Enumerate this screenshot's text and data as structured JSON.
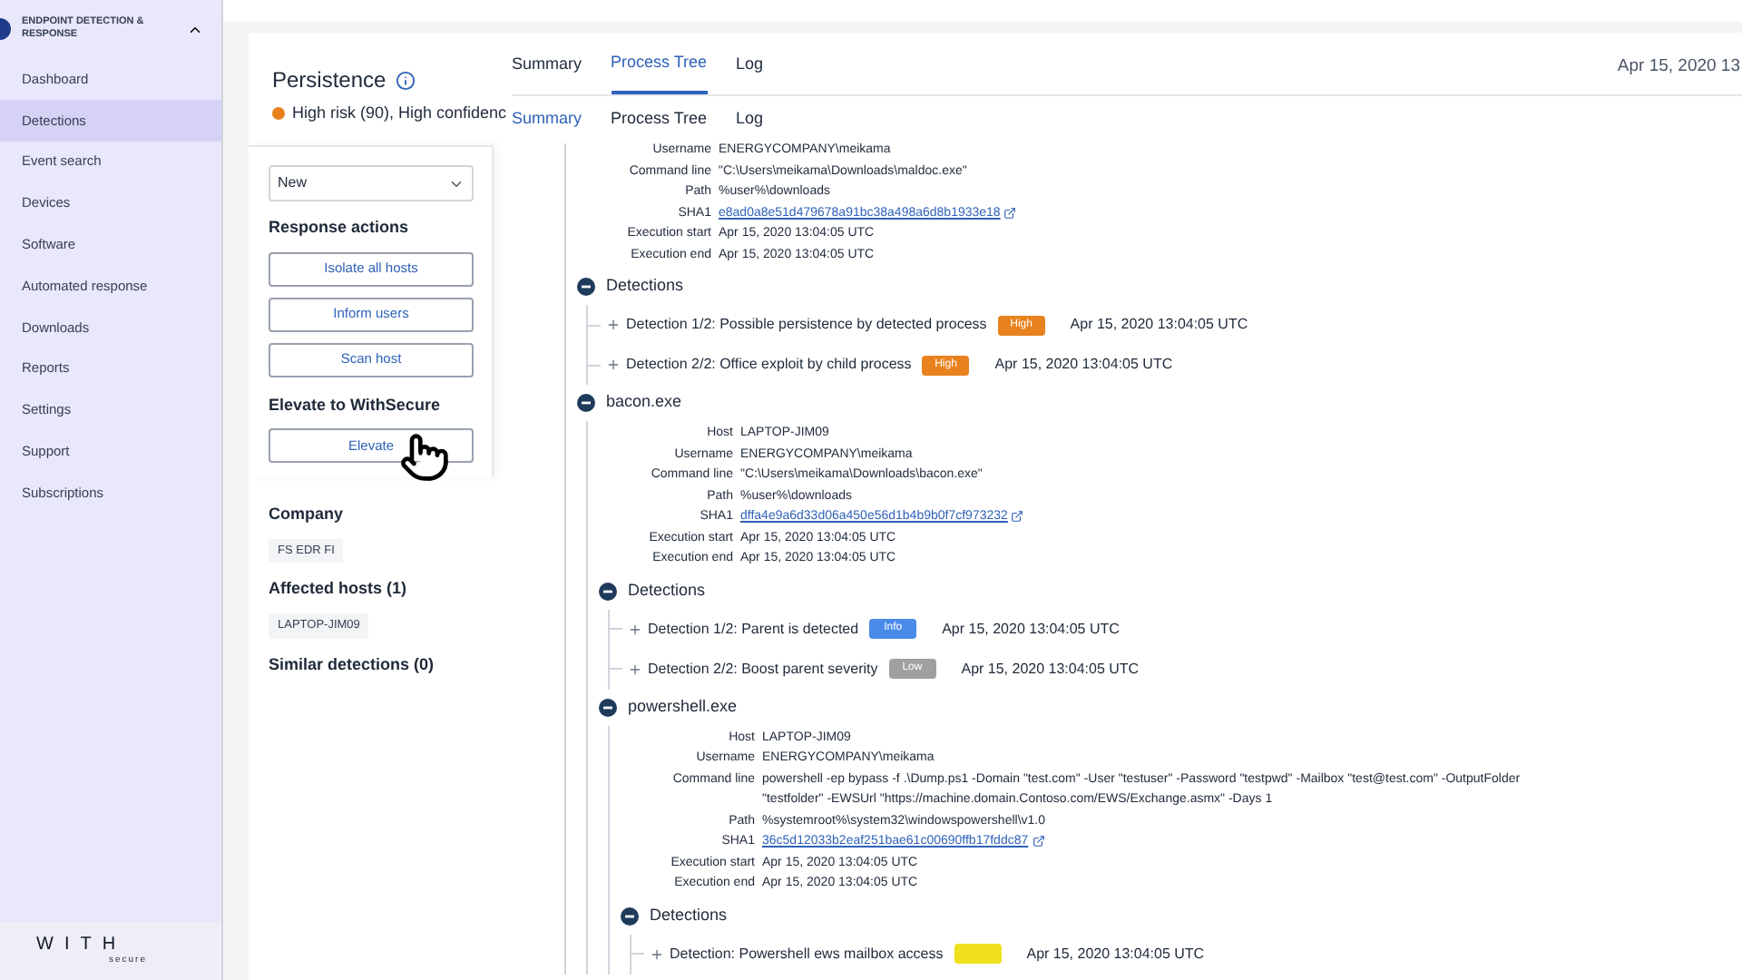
{
  "sidebar": {
    "section": {
      "title": "ENDPOINT DETECTION & RESPONSE",
      "expanded": true
    },
    "items": [
      {
        "label": "Dashboard",
        "selected": false
      },
      {
        "label": "Detections",
        "selected": true
      },
      {
        "label": "Event search",
        "selected": false
      },
      {
        "label": "Devices",
        "selected": false
      },
      {
        "label": "Software",
        "selected": false
      },
      {
        "label": "Automated response",
        "selected": false
      },
      {
        "label": "Downloads",
        "selected": false
      },
      {
        "label": "Reports",
        "selected": false
      },
      {
        "label": "Settings",
        "selected": false
      },
      {
        "label": "Support",
        "selected": false
      },
      {
        "label": "Subscriptions",
        "selected": false
      }
    ],
    "logo": {
      "word": "WITH",
      "sub": "secure"
    }
  },
  "detection": {
    "title": "Persistence",
    "risk": {
      "text": "High risk (90), High confidenc",
      "color": "#e8821e"
    },
    "date": "Apr 15, 2020 13"
  },
  "left_panel": {
    "status": {
      "value": "New"
    },
    "response_title": "Response actions",
    "response_buttons": [
      "Isolate all hosts",
      "Inform users",
      "Scan host"
    ],
    "elevate_title": "Elevate to WithSecure",
    "elevate_button": "Elevate",
    "company_title": "Company",
    "company_tag": "FS EDR FI",
    "hosts_title": "Affected hosts (1)",
    "host_tags": [
      "LAPTOP-JIM09"
    ],
    "similar_title": "Similar detections (0)"
  },
  "tabs": [
    {
      "label": "Summary",
      "selected": false
    },
    {
      "label": "Process Tree",
      "selected": true
    },
    {
      "label": "Log",
      "selected": false
    }
  ],
  "tabs_overlay": [
    {
      "label": "Summary",
      "selected": true
    },
    {
      "label": "Process Tree",
      "selected": false
    },
    {
      "label": "Log",
      "selected": false
    }
  ],
  "process_tree": [
    {
      "fields": [
        {
          "label": "Username",
          "value": "ENERGYCOMPANY\\meikama",
          "kind": "text"
        },
        {
          "label": "Command line",
          "value": "\"C:\\Users\\meikama\\Downloads\\maldoc.exe\"",
          "kind": "text"
        },
        {
          "label": "Path",
          "value": "%user%\\downloads",
          "kind": "text"
        },
        {
          "label": "SHA1",
          "value": "e8ad0a8e51d479678a91bc38a498a6d8b1933e18",
          "kind": "link"
        },
        {
          "label": "Execution start",
          "value": "Apr 15, 2020 13:04:05 UTC",
          "kind": "text"
        },
        {
          "label": "Execution end",
          "value": "Apr 15, 2020 13:04:05 UTC",
          "kind": "text"
        }
      ],
      "detections_title": "Detections",
      "detections": [
        {
          "title": "Detection 1/2: Possible persistence by detected process",
          "badge": {
            "label": "High",
            "color": "#e8821e"
          },
          "time": "Apr 15, 2020 13:04:05 UTC"
        },
        {
          "title": "Detection 2/2: Office exploit by child process",
          "badge": {
            "label": "High",
            "color": "#e8821e"
          },
          "time": "Apr 15, 2020 13:04:05 UTC"
        }
      ],
      "children": [
        {
          "name": "bacon.exe",
          "expanded": true,
          "fields": [
            {
              "label": "Host",
              "value": "LAPTOP-JIM09",
              "kind": "text"
            },
            {
              "label": "Username",
              "value": "ENERGYCOMPANY\\meikama",
              "kind": "text"
            },
            {
              "label": "Command line",
              "value": "\"C:\\Users\\meikama\\Downloads\\bacon.exe\"",
              "kind": "text"
            },
            {
              "label": "Path",
              "value": "%user%\\downloads",
              "kind": "text"
            },
            {
              "label": "SHA1",
              "value": "dffa4e9a6d33d06a450e56d1b4b9b0f7cf973232",
              "kind": "link"
            },
            {
              "label": "Execution start",
              "value": "Apr 15, 2020 13:04:05 UTC",
              "kind": "text"
            },
            {
              "label": "Execution end",
              "value": "Apr 15, 2020 13:04:05 UTC",
              "kind": "text"
            }
          ],
          "detections_title": "Detections",
          "detections": [
            {
              "title": "Detection 1/2: Parent is detected",
              "badge": {
                "label": "Info",
                "color": "#4a8ae8"
              },
              "time": "Apr 15, 2020 13:04:05 UTC"
            },
            {
              "title": "Detection 2/2: Boost parent severity",
              "badge": {
                "label": "Low",
                "color": "#a0a0a0"
              },
              "time": "Apr 15, 2020 13:04:05 UTC"
            }
          ],
          "children": [
            {
              "name": "powershell.exe",
              "expanded": true,
              "fields": [
                {
                  "label": "Host",
                  "value": "LAPTOP-JIM09",
                  "kind": "text"
                },
                {
                  "label": "Username",
                  "value": "ENERGYCOMPANY\\meikama",
                  "kind": "text"
                },
                {
                  "label": "Command line",
                  "value": "powershell -ep bypass -f .\\Dump.ps1 -Domain \"test.com\" -User \"testuser\" -Password \"testpwd\" -Mailbox \"test@test.com\" -OutputFolder \"testfolder\" -EWSUrl \"https://machine.domain.Contoso.com/EWS/Exchange.asmx\" -Days 1",
                  "kind": "text"
                },
                {
                  "label": "Path",
                  "value": "%systemroot%\\system32\\windowspowershell\\v1.0",
                  "kind": "text"
                },
                {
                  "label": "SHA1",
                  "value": "36c5d12033b2eaf251bae61c00690ffb17fddc87",
                  "kind": "link"
                },
                {
                  "label": "Execution start",
                  "value": "Apr 15, 2020 13:04:05 UTC",
                  "kind": "text"
                },
                {
                  "label": "Execution end",
                  "value": "Apr 15, 2020 13:04:05 UTC",
                  "kind": "text"
                }
              ],
              "detections_title": "Detections",
              "detections": [
                {
                  "title": "Detection: Powershell ews mailbox access",
                  "badge": {
                    "color": "#f0e020"
                  },
                  "time": "Apr 15, 2020 13:04:05 UTC"
                }
              ]
            }
          ]
        }
      ]
    }
  ]
}
